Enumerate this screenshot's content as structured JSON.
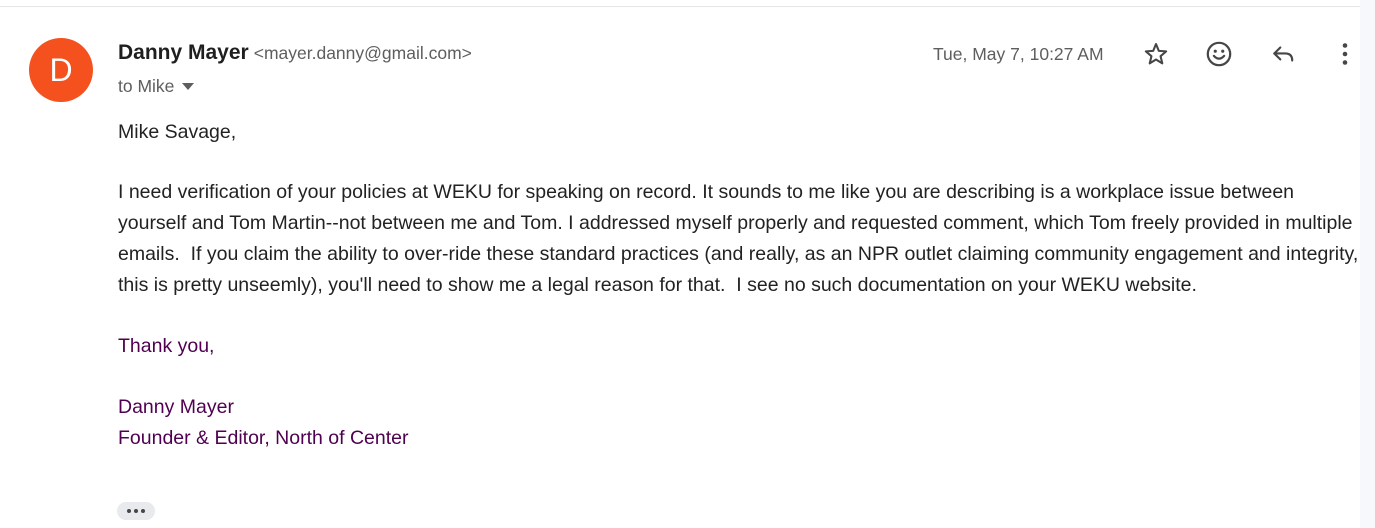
{
  "message": {
    "avatar_letter": "D",
    "avatar_color": "#f4511e",
    "sender_name": "Danny Mayer",
    "sender_email": "<mayer.danny@gmail.com>",
    "recipient": "to Mike",
    "timestamp": "Tue, May 7, 10:27 AM",
    "actions": [
      {
        "name": "star",
        "icon": "star-outline-icon"
      },
      {
        "name": "add-reaction",
        "icon": "smiley-icon"
      },
      {
        "name": "reply",
        "icon": "reply-arrow-icon"
      },
      {
        "name": "more",
        "icon": "vertical-dots-icon"
      }
    ]
  },
  "body": {
    "greeting": "Mike Savage,",
    "paragraph": "I need verification of your policies at WEKU for speaking on record. It sounds to me like you are describing is a workplace issue between yourself and Tom Martin--not between me and Tom. I addressed myself properly and requested comment, which Tom freely provided in multiple emails.  If you claim the ability to over-ride these standard practices (and really, as an NPR outlet claiming community engagement and integrity, this is pretty unseemly), you'll need to show me a legal reason for that.  I see no such documentation on your WEKU website.",
    "closing": "Thank you,",
    "signature_name": "Danny Mayer",
    "signature_title": "Founder & Editor, North of Center",
    "signature_color": "#500050"
  },
  "trimmed_content": {
    "icon": "ellipsis-icon"
  }
}
